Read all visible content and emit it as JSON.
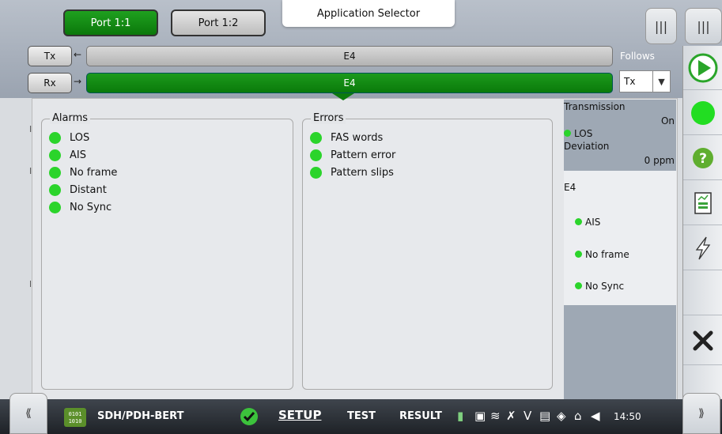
{
  "header": {
    "tabs": [
      {
        "label": "Port 1:1",
        "active": true
      },
      {
        "label": "Port 1:2",
        "active": false
      }
    ],
    "app_selector": "Application Selector"
  },
  "signal": {
    "tx": {
      "button": "Tx",
      "bar": "E4"
    },
    "rx": {
      "button": "Rx",
      "bar": "E4"
    },
    "follows_label": "Follows",
    "follows_value": "Tx"
  },
  "alarms": {
    "title": "Alarms",
    "items": [
      "LOS",
      "AIS",
      "No frame",
      "Distant",
      "No Sync"
    ]
  },
  "errors": {
    "title": "Errors",
    "items": [
      "FAS words",
      "Pattern error",
      "Pattern slips"
    ]
  },
  "status": {
    "transmission_label": "Transmission",
    "transmission_value": "On",
    "los_label": "LOS",
    "deviation_label": "Deviation",
    "deviation_value": "0 ppm",
    "e4_label": "E4",
    "e4_items": [
      "AIS",
      "No frame",
      "No Sync"
    ]
  },
  "bottom": {
    "app_name": "SDH/PDH-BERT",
    "setup": "SETUP",
    "test": "TEST",
    "result": "RESULT",
    "clock": "14:50"
  },
  "colors": {
    "green": "#2bd42b",
    "active_tab": "#0b780b"
  }
}
